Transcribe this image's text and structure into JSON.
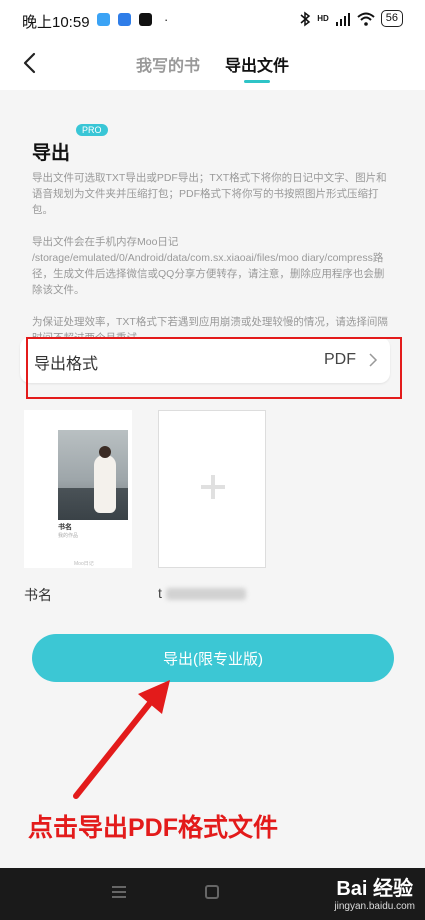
{
  "status_bar": {
    "time": "晚上10:59",
    "dot": "·",
    "network": "HD",
    "battery": "56"
  },
  "header": {
    "tabs": [
      {
        "label": "我写的书",
        "active": false
      },
      {
        "label": "导出文件",
        "active": true
      }
    ]
  },
  "export": {
    "title": "导出",
    "badge": "PRO",
    "paragraphs": [
      "导出文件可选取TXT导出或PDF导出；TXT格式下将你的日记中文字、图片和语音规划为文件夹并压缩打包；PDF格式下将你写的书按照图片形式压缩打包。",
      "导出文件会在手机内存Moo日记 /storage/emulated/0/Android/data/com.sx.xiaoai/files/moo diary/compress路径，生成文件后选择微信或QQ分享方便转存，请注意，删除应用程序也会删除该文件。",
      "为保证处理效率，TXT格式下若遇到应用崩溃或处理较慢的情况，请选择间隔时间不超过两个月重试。"
    ],
    "format_label": "导出格式",
    "format_value": "PDF",
    "book_cover_title": "书名",
    "book_cover_subtitle": "我的作品",
    "book_cover_brand": "Moo日记",
    "book_caption": "书名",
    "second_caption_prefix": "t",
    "button_label": "导出(限专业版)"
  },
  "annotation": "点击导出PDF格式文件",
  "watermark": {
    "main": "Bai 经验",
    "sub": "jingyan.baidu.com"
  },
  "colors": {
    "accent": "#3cc7d4",
    "annotation_red": "#e31b1b"
  }
}
